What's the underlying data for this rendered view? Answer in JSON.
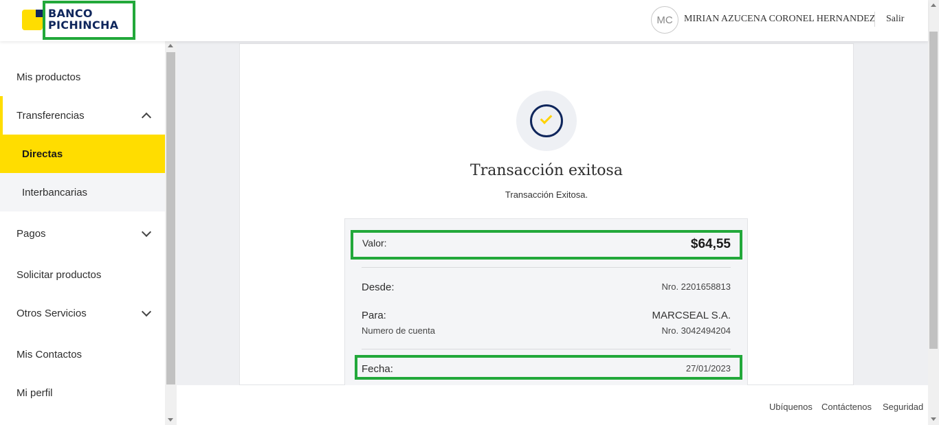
{
  "header": {
    "brand_line1": "BANCO",
    "brand_line2": "PICHINCHA",
    "avatar_initials": "MC",
    "user_name": "MIRIAN AZUCENA CORONEL HERNANDEZ",
    "logout_label": "Salir"
  },
  "sidebar": {
    "items": [
      {
        "label": "Mis productos"
      },
      {
        "label": "Transferencias",
        "expanded": true,
        "subitems": [
          {
            "label": "Directas",
            "active": true
          },
          {
            "label": "Interbancarias"
          }
        ]
      },
      {
        "label": "Pagos",
        "expanded": false
      },
      {
        "label": "Solicitar productos"
      },
      {
        "label": "Otros Servicios",
        "expanded": false
      },
      {
        "label": "Mis Contactos"
      },
      {
        "label": "Mi perfil"
      }
    ]
  },
  "result": {
    "icon": "check-circle-icon",
    "title": "Transacción exitosa",
    "subtitle": "Transacción Exitosa."
  },
  "details": {
    "amount_label": "Valor:",
    "amount_value": "$64,55",
    "from_label": "Desde:",
    "from_value": "Nro. 2201658813",
    "to_label": "Para:",
    "to_value": "MARCSEAL S.A.",
    "account_label": "Numero de cuenta",
    "account_value": "Nro. 3042494204",
    "date_label": "Fecha:",
    "date_value": "27/01/2023"
  },
  "footer": {
    "links": [
      "Ubíquenos",
      "Contáctenos",
      "Seguridad"
    ]
  },
  "colors": {
    "brand_yellow": "#ffdd00",
    "brand_navy": "#0f265c",
    "highlight_green": "#22a83a"
  }
}
